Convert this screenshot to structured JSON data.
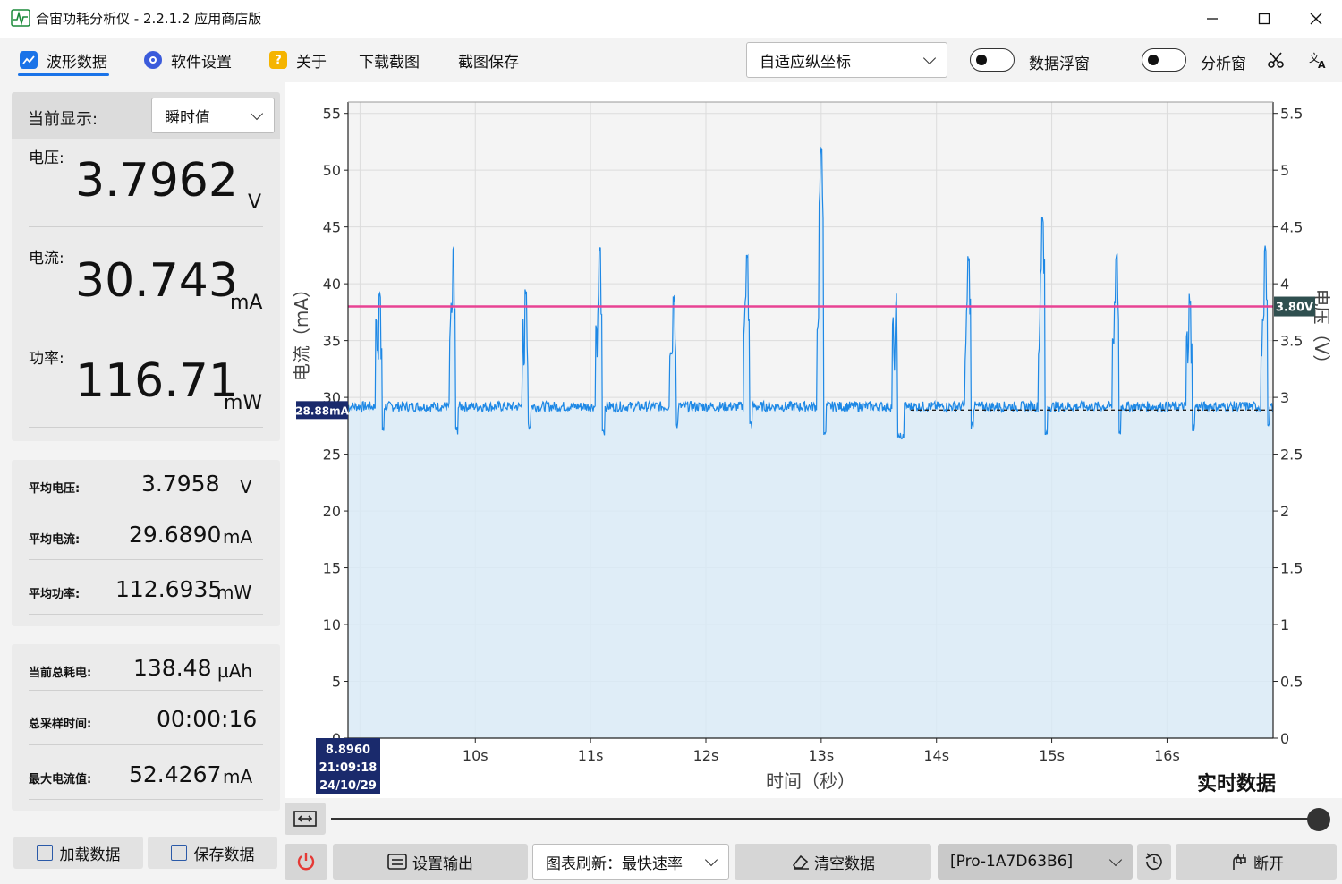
{
  "window": {
    "title": "合宙功耗分析仪 - 2.2.1.2 应用商店版",
    "logo_icon": "waveform-logo-icon"
  },
  "menu": {
    "waveform": "波形数据",
    "settings": "软件设置",
    "about": "关于",
    "download_screenshot": "下载截图",
    "save_screenshot": "截图保存",
    "axis_mode": "自适应纵坐标",
    "data_float": "数据浮窗",
    "analysis_window": "分析窗"
  },
  "left_panel": {
    "current_display_label": "当前显示:",
    "current_display_value": "瞬时值",
    "voltage": {
      "label": "电压:",
      "value": "3.7962",
      "unit": "V"
    },
    "current": {
      "label": "电流:",
      "value": "30.743",
      "unit": "mA"
    },
    "power": {
      "label": "功率:",
      "value": "116.71",
      "unit": "mW"
    },
    "avg_voltage": {
      "label": "平均电压:",
      "value": "3.7958",
      "unit": "V"
    },
    "avg_current": {
      "label": "平均电流:",
      "value": "29.6890",
      "unit": "mA"
    },
    "avg_power": {
      "label": "平均功率:",
      "value": "112.6935",
      "unit": "mW"
    },
    "total_consumption": {
      "label": "当前总耗电:",
      "value": "138.48",
      "unit": "µAh"
    },
    "total_time": {
      "label": "总采样时间:",
      "value": "00:00:16"
    },
    "max_current": {
      "label": "最大电流值:",
      "value": "52.4267",
      "unit": "mA"
    },
    "load_button": "加载数据",
    "save_button": "保存数据"
  },
  "chart": {
    "realtime_label": "实时数据",
    "cursor_time": "8.8960",
    "cursor_clock": "21:09:18",
    "cursor_date": "24/10/29",
    "current_marker": "28.88mA",
    "voltage_marker": "3.80V"
  },
  "chart_data": {
    "type": "line",
    "xlabel": "时间（秒）",
    "ylabel": "电流（mA）",
    "y2label": "电压（V）",
    "x_ticks": [
      "10s",
      "11s",
      "12s",
      "13s",
      "14s",
      "15s",
      "16s"
    ],
    "x_tick_values": [
      10,
      11,
      12,
      13,
      14,
      15,
      16
    ],
    "xlim": [
      8.896,
      16.92
    ],
    "ylim": [
      0,
      56
    ],
    "y_ticks": [
      0,
      5,
      10,
      15,
      20,
      25,
      30,
      35,
      40,
      45,
      50,
      55
    ],
    "y2lim": [
      0,
      5.6
    ],
    "y2_ticks": [
      "0",
      "0.5",
      "1",
      "1.5",
      "2",
      "2.5",
      "3",
      "3.5",
      "4",
      "4.5",
      "5",
      "5.5"
    ],
    "grid": true,
    "series": [
      {
        "name": "电流",
        "color": "#1e88e5",
        "baseline": 29.2,
        "unit": "mA",
        "spikes": [
          {
            "x": 9.17,
            "peak": 39.3,
            "dip": 26.7
          },
          {
            "x": 9.81,
            "peak": 43.8,
            "dip": 26.7
          },
          {
            "x": 10.44,
            "peak": 39.6,
            "dip": 27.2
          },
          {
            "x": 11.08,
            "peak": 43.7,
            "dip": 26.6
          },
          {
            "x": 11.72,
            "peak": 39.6,
            "dip": 27.2
          },
          {
            "x": 12.36,
            "peak": 43.3,
            "dip": 27.2
          },
          {
            "x": 13.0,
            "peak": 52.4,
            "dip": 26.6
          },
          {
            "x": 13.65,
            "peak": 39.3,
            "dip": 26.2
          },
          {
            "x": 14.28,
            "peak": 43.2,
            "dip": 27.2
          },
          {
            "x": 14.92,
            "peak": 46.2,
            "dip": 26.2
          },
          {
            "x": 15.56,
            "peak": 43.2,
            "dip": 26.6
          },
          {
            "x": 16.2,
            "peak": 39.3,
            "dip": 27.0
          },
          {
            "x": 16.85,
            "peak": 43.5,
            "dip": 27.0
          }
        ]
      },
      {
        "name": "电压",
        "color": "#e84393",
        "value": 3.8,
        "unit": "V"
      }
    ]
  },
  "bottom_bar": {
    "set_output": "设置输出",
    "refresh": "图表刷新：最快速率",
    "clear_data": "清空数据",
    "device": "[Pro-1A7D63B6]",
    "disconnect": "断开"
  },
  "colors": {
    "accent": "#1a73e8",
    "current_line": "#1e88e5",
    "voltage_line": "#e84393",
    "power_button": "#e53935",
    "marker_bg": "#1a2a6c",
    "voltage_marker_bg": "#2f4f4f"
  }
}
